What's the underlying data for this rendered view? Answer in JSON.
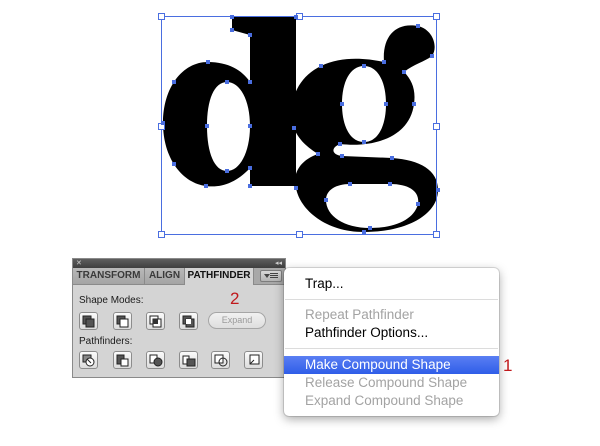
{
  "panel": {
    "tabs": [
      {
        "label": "TRANSFORM",
        "active": false
      },
      {
        "label": "ALIGN",
        "active": false
      },
      {
        "label": "PATHFINDER",
        "active": true
      }
    ],
    "shape_modes_label": "Shape Modes:",
    "pathfinders_label": "Pathfinders:",
    "expand_label": "Expand",
    "shape_mode_buttons": [
      "unite-icon",
      "minus-front-icon",
      "intersect-icon",
      "exclude-icon"
    ],
    "pathfinder_buttons": [
      "divide-icon",
      "trim-icon",
      "merge-icon",
      "crop-icon",
      "outline-icon",
      "minus-back-icon"
    ]
  },
  "menu": {
    "items": [
      {
        "label": "Trap...",
        "state": "enabled"
      },
      {
        "label": "Repeat Pathfinder",
        "state": "disabled"
      },
      {
        "label": "Pathfinder Options...",
        "state": "enabled"
      },
      {
        "label": "Make Compound Shape",
        "state": "highlighted"
      },
      {
        "label": "Release Compound Shape",
        "state": "disabled"
      },
      {
        "label": "Expand Compound Shape",
        "state": "disabled"
      }
    ]
  },
  "callouts": {
    "step_1": "1",
    "step_2": "2"
  },
  "colors": {
    "selection": "#4a6ee0",
    "highlight": "#3d66ee",
    "callout": "#c0191c",
    "glyph": "#000000"
  }
}
